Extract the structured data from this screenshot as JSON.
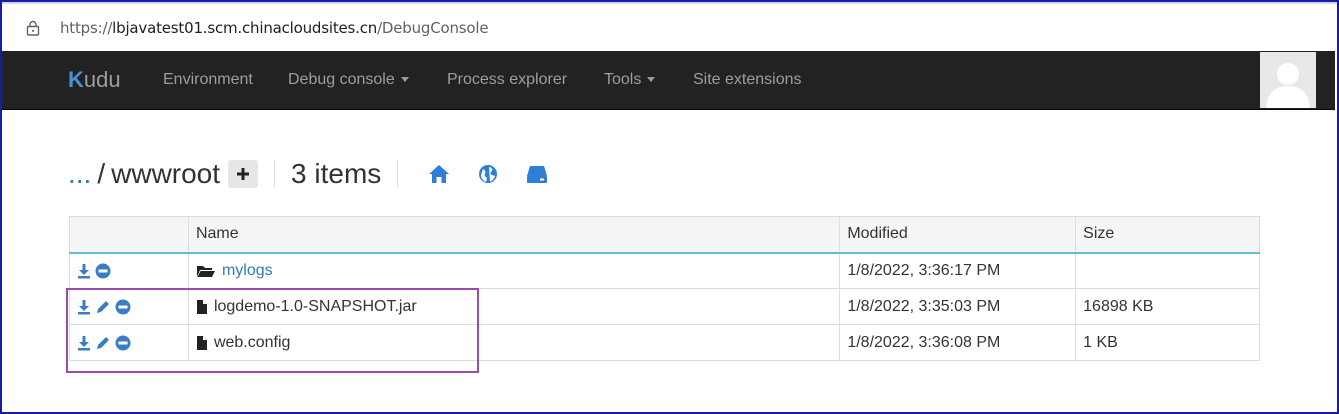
{
  "browser": {
    "url_prefix": "https://",
    "url_host": "lbjavatest01.scm.chinacloudsites.cn",
    "url_path": "/DebugConsole"
  },
  "navbar": {
    "brand_k": "K",
    "brand_rest": "udu",
    "items": [
      {
        "label": "Environment",
        "has_caret": false
      },
      {
        "label": "Debug console",
        "has_caret": true
      },
      {
        "label": "Process explorer",
        "has_caret": false
      },
      {
        "label": "Tools",
        "has_caret": true
      },
      {
        "label": "Site extensions",
        "has_caret": false
      }
    ]
  },
  "breadcrumb": {
    "ellipsis": "...",
    "separator": "/",
    "current_dir": "wwwroot",
    "item_count": "3 items"
  },
  "table": {
    "headers": [
      "",
      "Name",
      "Modified",
      "Size"
    ],
    "rows": [
      {
        "type": "folder",
        "name": "mylogs",
        "modified": "1/8/2022, 3:36:17 PM",
        "size": "",
        "editable": false
      },
      {
        "type": "file",
        "name": "logdemo-1.0-SNAPSHOT.jar",
        "modified": "1/8/2022, 3:35:03 PM",
        "size": "16898 KB",
        "editable": true
      },
      {
        "type": "file",
        "name": "web.config",
        "modified": "1/8/2022, 3:36:08 PM",
        "size": "1 KB",
        "editable": true
      }
    ]
  },
  "colors": {
    "navbar_bg": "#222222",
    "link": "#337ab7",
    "icon_blue": "#3b7dc4",
    "highlight_border": "#9b4bb0",
    "header_underline": "#5bc0de"
  },
  "icons": [
    "lock-icon",
    "plus-icon",
    "home-icon",
    "globe-icon",
    "drive-icon",
    "download-icon",
    "edit-icon",
    "delete-icon",
    "folder-icon",
    "file-icon",
    "avatar-icon"
  ]
}
